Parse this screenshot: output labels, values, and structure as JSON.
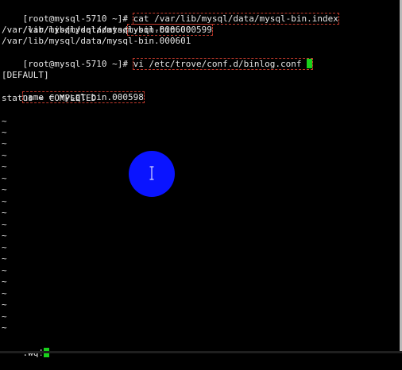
{
  "terminal": {
    "lines": [
      {
        "prompt": "[root@mysql-5710 ~]# ",
        "command": "cat /var/lib/mysql/data/mysql-bin.index"
      },
      {
        "text": "/var/lib/mysql/data/",
        "highlight": "mysql-bin.000599"
      },
      {
        "text": "/var/lib/mysql/data/mysql-bin.000600"
      },
      {
        "text": "/var/lib/mysql/data/mysql-bin.000601"
      },
      {
        "prompt": "[root@mysql-5710 ~]# ",
        "command": "vi /etc/trove/conf.d/binlog.conf"
      },
      {
        "text": ""
      },
      {
        "text": "[DEFAULT]"
      },
      {
        "highlight": "name = mysql-bin.000598"
      },
      {
        "text": "status = COMPLETED"
      }
    ],
    "tilde": "~",
    "command_line": ":wq!"
  },
  "colors": {
    "background": "#000000",
    "text": "#e6e6e6",
    "cursor": "#19d11b",
    "highlight_box": "#c0392b",
    "pointer_circle": "#0a14ff"
  },
  "icons": {
    "pointer": "text-cursor-icon"
  }
}
